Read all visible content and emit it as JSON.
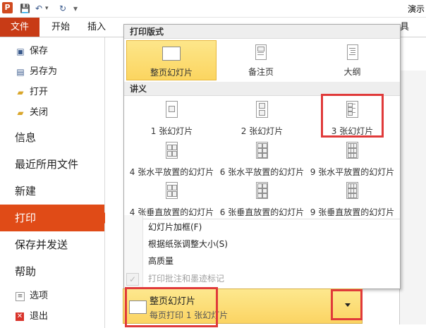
{
  "window": {
    "app_letter": "P",
    "title_partial": "演示"
  },
  "qat": {
    "save_glyph": "💾",
    "undo_glyph": "↶",
    "redo_glyph": "↻",
    "customize_glyph": "▾"
  },
  "ribbon": {
    "file_tab": "文件",
    "tabs": [
      "开始",
      "插入"
    ],
    "right_edge_char": "具"
  },
  "nav": {
    "small_items": [
      {
        "label": "保存",
        "icon": "save-icon"
      },
      {
        "label": "另存为",
        "icon": "save-as-icon"
      },
      {
        "label": "打开",
        "icon": "open-folder-icon"
      },
      {
        "label": "关闭",
        "icon": "close-folder-icon"
      }
    ],
    "big_items": [
      "信息",
      "最近所用文件",
      "新建",
      "打印",
      "保存并发送",
      "帮助"
    ],
    "active_item": "打印",
    "bottom_items": [
      {
        "label": "选项",
        "icon": "options-icon"
      },
      {
        "label": "退出",
        "icon": "exit-icon"
      }
    ]
  },
  "panel": {
    "print_layout_header": "打印版式",
    "print_layouts": [
      {
        "label": "整页幻灯片",
        "selected": true
      },
      {
        "label": "备注页",
        "selected": false
      },
      {
        "label": "大纲",
        "selected": false
      }
    ],
    "handouts_header": "讲义",
    "handouts_row1": [
      "1 张幻灯片",
      "2 张幻灯片",
      "3 张幻灯片"
    ],
    "handouts_row2": [
      "4 张水平放置的幻灯片",
      "6 张水平放置的幻灯片",
      "9 张水平放置的幻灯片"
    ],
    "handouts_row3": [
      "4 张垂直放置的幻灯片",
      "6 张垂直放置的幻灯片",
      "9 张垂直放置的幻灯片"
    ],
    "options": [
      {
        "label": "幻灯片加框(F)",
        "enabled": true
      },
      {
        "label": "根据纸张调整大小(S)",
        "enabled": true
      },
      {
        "label": "高质量",
        "enabled": true
      },
      {
        "label": "打印批注和墨迹标记",
        "enabled": false,
        "checked": true
      }
    ]
  },
  "combo": {
    "title": "整页幻灯片",
    "subtitle": "每页打印 1 张幻灯片"
  },
  "colors": {
    "accent": "#e04b17",
    "file_tab": "#c83b16",
    "highlight": "#fbd560",
    "annotation": "#e03a3a"
  }
}
